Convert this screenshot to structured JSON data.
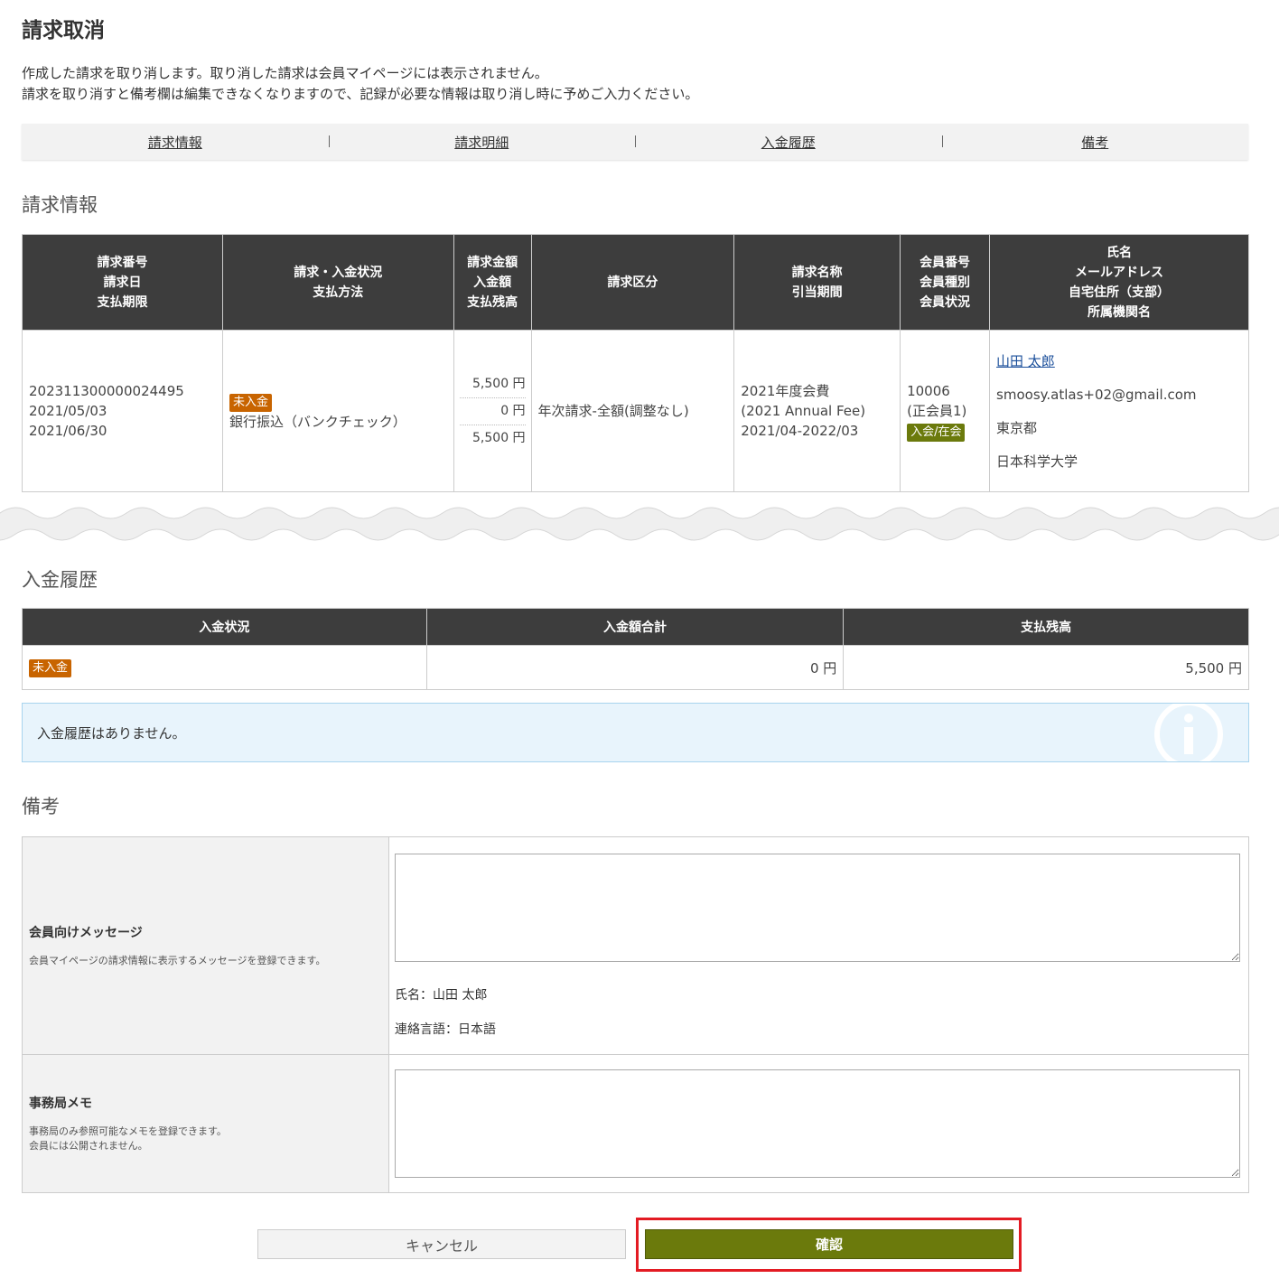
{
  "page": {
    "title": "請求取消",
    "intro_line1": "作成した請求を取り消します。取り消した請求は会員マイページには表示されません。",
    "intro_line2": "請求を取り消すと備考欄は編集できなくなりますので、記録が必要な情報は取り消し時に予めご入力ください。"
  },
  "anchor_nav": [
    "請求情報",
    "請求明細",
    "入金履歴",
    "備考"
  ],
  "invoice_section": {
    "title": "請求情報",
    "headers": {
      "col1": [
        "請求番号",
        "請求日",
        "支払期限"
      ],
      "col2": [
        "請求・入金状況",
        "支払方法"
      ],
      "col3": [
        "請求金額",
        "入金額",
        "支払残高"
      ],
      "col4": [
        "請求区分"
      ],
      "col5": [
        "請求名称",
        "引当期間"
      ],
      "col6": [
        "会員番号",
        "会員種別",
        "会員状況"
      ],
      "col7": [
        "氏名",
        "メールアドレス",
        "自宅住所（支部）",
        "所属機関名"
      ]
    },
    "row": {
      "invoice_no": "202311300000024495",
      "invoice_date": "2021/05/03",
      "due_date": "2021/06/30",
      "status_badge": "未入金",
      "payment_method": "銀行振込（バンクチェック）",
      "billed": "5,500 円",
      "paid": "0 円",
      "balance": "5,500 円",
      "category": "年次請求-全額(調整なし)",
      "name_line1": "2021年度会費",
      "name_line2": "(2021 Annual Fee)",
      "period": "2021/04-2022/03",
      "member_no": "10006",
      "member_type": "(正会員1)",
      "member_status_badge": "入会/在会",
      "person_name": "山田 太郎",
      "email": "smoosy.atlas+02@gmail.com",
      "address": "東京都",
      "institution": "日本科学大学"
    }
  },
  "payment_section": {
    "title": "入金履歴",
    "headers": [
      "入金状況",
      "入金額合計",
      "支払残高"
    ],
    "status_badge": "未入金",
    "total_paid": "0 円",
    "balance": "5,500 円",
    "empty_message": "入金履歴はありません。"
  },
  "memo_section": {
    "title": "備考",
    "member_message_label": "会員向けメッセージ",
    "member_message_desc": "会員マイページの請求情報に表示するメッセージを登録できます。",
    "member_message_value": "",
    "name_line": "氏名：山田 太郎",
    "lang_line": "連絡言語：日本語",
    "office_memo_label": "事務局メモ",
    "office_memo_desc1": "事務局のみ参照可能なメモを登録できます。",
    "office_memo_desc2": "会員には公開されません。",
    "office_memo_value": ""
  },
  "buttons": {
    "cancel": "キャンセル",
    "confirm": "確認"
  },
  "colors": {
    "header_bg": "#3d3d3d",
    "unpaid_badge": "#c86400",
    "member_badge": "#6b7a0c",
    "confirm_button": "#6b7a0c",
    "balance_red": "#c0103a",
    "highlight_frame": "#e31b23",
    "info_bg": "#e8f4fc"
  }
}
